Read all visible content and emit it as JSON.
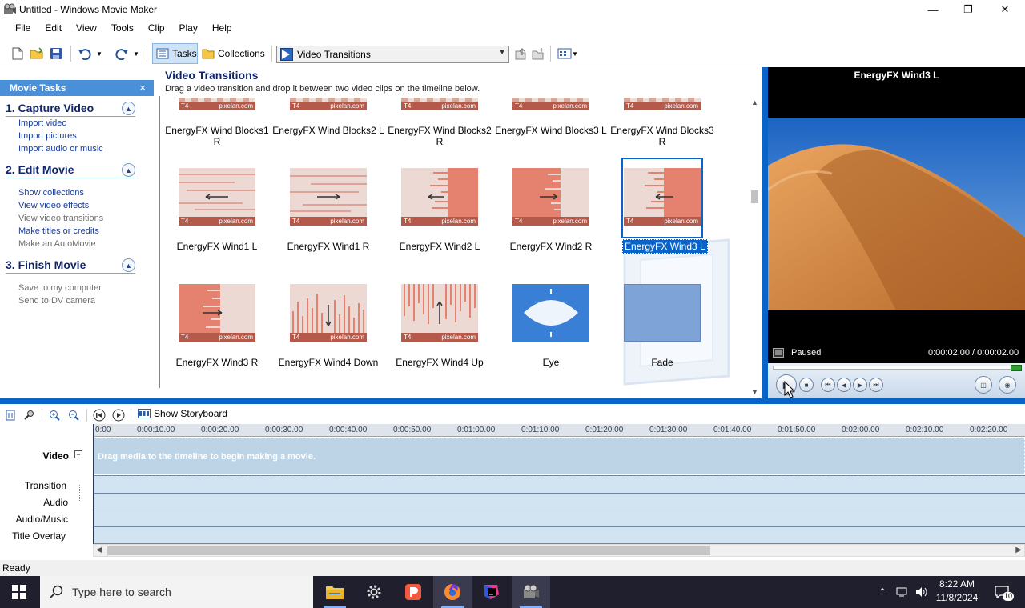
{
  "window": {
    "title": "Untitled - Windows Movie Maker",
    "minimize_icon": "minimize-icon",
    "maximize_icon": "restore-icon",
    "close_icon": "close-icon"
  },
  "menu": [
    "File",
    "Edit",
    "View",
    "Tools",
    "Clip",
    "Play",
    "Help"
  ],
  "toolbar": {
    "tasks_label": "Tasks",
    "collections_label": "Collections",
    "view_dropdown_value": "Video Transitions"
  },
  "movie_tasks": {
    "header": "Movie Tasks",
    "close": "×",
    "sections": [
      {
        "title": "1. Capture Video",
        "links": [
          {
            "label": "Import video",
            "enabled": true
          },
          {
            "label": "Import pictures",
            "enabled": true
          },
          {
            "label": "Import audio or music",
            "enabled": true
          }
        ]
      },
      {
        "title": "2. Edit Movie",
        "links": [
          {
            "label": "Show collections",
            "enabled": true
          },
          {
            "label": "View video effects",
            "enabled": true
          },
          {
            "label": "View video transitions",
            "enabled": false
          },
          {
            "label": "Make titles or credits",
            "enabled": true
          },
          {
            "label": "Make an AutoMovie",
            "enabled": false
          }
        ]
      },
      {
        "title": "3. Finish Movie",
        "links": [
          {
            "label": "Save to my computer",
            "enabled": false
          },
          {
            "label": "Send to DV camera",
            "enabled": false
          }
        ]
      }
    ]
  },
  "content": {
    "title": "Video Transitions",
    "subtitle": "Drag a video transition and drop it between two video clips on the timeline below.",
    "thumb_logo_left": "T4",
    "thumb_logo_right": "pixelan.com",
    "row1": [
      "EnergyFX Wind Blocks1 R",
      "EnergyFX Wind Blocks2 L",
      "EnergyFX Wind Blocks2 R",
      "EnergyFX Wind Blocks3 L",
      "EnergyFX Wind Blocks3 R"
    ],
    "row2": [
      "EnergyFX Wind1 L",
      "EnergyFX Wind1 R",
      "EnergyFX Wind2 L",
      "EnergyFX Wind2 R",
      "EnergyFX Wind3 L"
    ],
    "row3": [
      "EnergyFX Wind3 R",
      "EnergyFX Wind4 Down",
      "EnergyFX Wind4 Up",
      "Eye",
      "Fade"
    ],
    "selected": "EnergyFX Wind3 L"
  },
  "monitor": {
    "title": "EnergyFX Wind3 L",
    "status": "Paused",
    "time": "0:00:02.00 / 0:00:02.00"
  },
  "timeline": {
    "storyboard_label": "Show Storyboard",
    "ticks": [
      "0:00",
      "0:00:10.00",
      "0:00:20.00",
      "0:00:30.00",
      "0:00:40.00",
      "0:00:50.00",
      "0:01:00.00",
      "0:01:10.00",
      "0:01:20.00",
      "0:01:30.00",
      "0:01:40.00",
      "0:01:50.00",
      "0:02:00.00",
      "0:02:10.00",
      "0:02:20.00"
    ],
    "hint": "Drag media to the timeline to begin making a movie.",
    "tracks": [
      "Video",
      "Transition",
      "Audio",
      "Audio/Music",
      "Title Overlay"
    ]
  },
  "statusbar": {
    "text": "Ready"
  },
  "taskbar": {
    "search_placeholder": "Type here to search",
    "time": "8:22 AM",
    "date": "11/8/2024",
    "notification_count": "10"
  },
  "colors": {
    "accent": "#0a64c8",
    "task_header": "#4a90d9"
  }
}
